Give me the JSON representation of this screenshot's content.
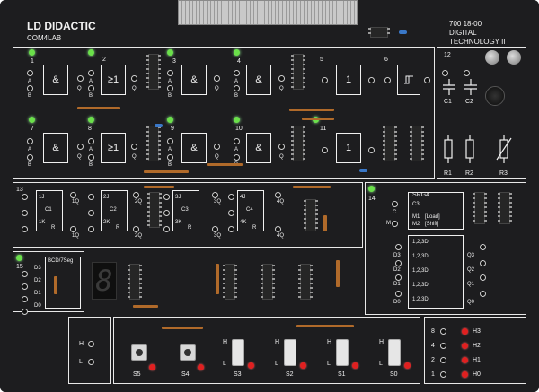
{
  "board": {
    "brand": "LD DIDACTIC",
    "model": "COM4LAB",
    "part_number": "700 18-00",
    "title_line1": "DIGITAL",
    "title_line2": "TECHNOLOGY II"
  },
  "gates_top": [
    {
      "num": "1",
      "sym": "&"
    },
    {
      "num": "2",
      "sym": "≥1"
    },
    {
      "num": "3",
      "sym": "&"
    },
    {
      "num": "4",
      "sym": "&"
    },
    {
      "num": "5",
      "sym": "1"
    },
    {
      "num": "6",
      "sym": ""
    }
  ],
  "gates_bottom": [
    {
      "num": "7",
      "sym": "&"
    },
    {
      "num": "8",
      "sym": "≥1"
    },
    {
      "num": "9",
      "sym": "&"
    },
    {
      "num": "10",
      "sym": "&"
    },
    {
      "num": "11",
      "sym": "1"
    }
  ],
  "pin_labels": {
    "a": "A",
    "b": "B",
    "q": "Q"
  },
  "passives": {
    "section": "12",
    "c1": "C1",
    "c2": "C2",
    "r1": "R1",
    "r2": "R2",
    "r3": "R3"
  },
  "flipflops": {
    "section": "13",
    "units": [
      {
        "j": "1J",
        "c": "C1",
        "k": "1K",
        "q": "1Q",
        "qn": "1Q"
      },
      {
        "j": "2J",
        "c": "C2",
        "k": "2K",
        "q": "2Q",
        "qn": "2Q"
      },
      {
        "j": "3J",
        "c": "C3",
        "k": "3K",
        "q": "3Q",
        "qn": "3Q"
      },
      {
        "j": "4J",
        "c": "C4",
        "k": "4K",
        "q": "4Q",
        "qn": "4Q"
      }
    ],
    "r_label": "R"
  },
  "shift_register": {
    "section": "14",
    "name": "SRG4",
    "c3": "C3",
    "m1": "M1",
    "m1_mode": "[Load]",
    "m2": "M2",
    "m2_mode": "[Shift]",
    "c_label": "C",
    "m_label": "M",
    "cells": [
      "1,2,3D",
      "1,2,3D",
      "1,2,3D",
      "1,2,3D",
      "1,2,3D"
    ],
    "inputs": [
      "D3",
      "D2",
      "D1",
      "D0"
    ],
    "outputs": [
      "Q3",
      "Q2",
      "Q1",
      "Q0"
    ]
  },
  "display": {
    "section": "15",
    "label": "BCD/7Seg",
    "digit": "8",
    "inputs": [
      "D3",
      "D2",
      "D1",
      "D0"
    ]
  },
  "switches": {
    "level_h": "H",
    "level_l": "L",
    "buttons": [
      "S5",
      "S4"
    ],
    "toggles": [
      "S3",
      "S2",
      "S1",
      "S0"
    ]
  },
  "outputs": {
    "lines": [
      {
        "value": "8",
        "name": "H3"
      },
      {
        "value": "4",
        "name": "H2"
      },
      {
        "value": "2",
        "name": "H1"
      },
      {
        "value": "1",
        "name": "H0"
      }
    ]
  },
  "colors": {
    "board": "#1d1d1f",
    "silkscreen": "#f2f2f2",
    "led_green": "#6be04a",
    "led_red": "#e02020"
  }
}
